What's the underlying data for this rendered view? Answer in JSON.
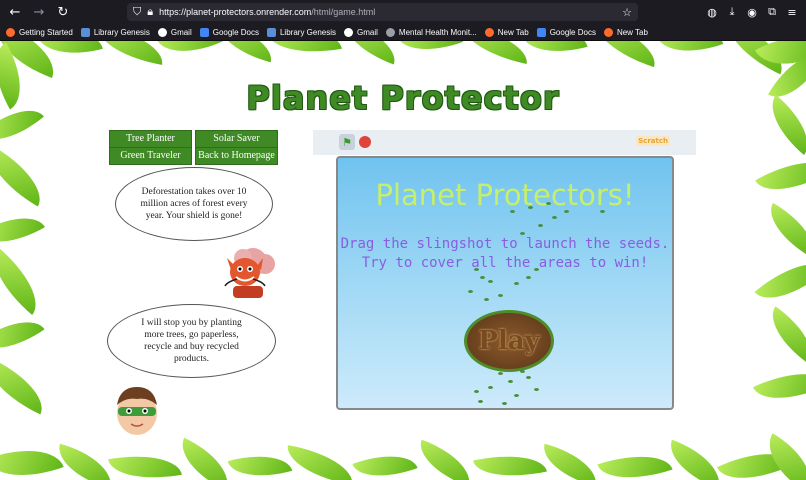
{
  "browser": {
    "url_host": "https://planet-protectors.onrender.com",
    "url_path": "/html/game.html",
    "bookmarks": [
      {
        "label": "Getting Started",
        "color": "#ff6b2d"
      },
      {
        "label": "Library Genesis",
        "color": "#5a8fd8"
      },
      {
        "label": "Gmail",
        "color": "#ffffff"
      },
      {
        "label": "Google Docs",
        "color": "#4285f4"
      },
      {
        "label": "Library Genesis",
        "color": "#5a8fd8"
      },
      {
        "label": "Gmail",
        "color": "#ffffff"
      },
      {
        "label": "Mental Health Monit...",
        "color": "#9aa0a6"
      },
      {
        "label": "New Tab",
        "color": "#ff6b2d"
      },
      {
        "label": "Google Docs",
        "color": "#4285f4"
      },
      {
        "label": "New Tab",
        "color": "#ff6b2d"
      }
    ]
  },
  "page": {
    "title": "Planet Protector",
    "nav": {
      "tree_planter": "Tree Planter",
      "solar_saver": "Solar Saver",
      "green_traveler": "Green Traveler",
      "back_home": "Back to Homepage"
    },
    "villain_speech": "Deforestation takes over 10 million acres of forest  every year. Your shield is gone!",
    "hero_speech": "I will stop you by planting more trees, go paperless, recycle and buy recycled products.",
    "stage_logo": "Scratch"
  },
  "game": {
    "title": "Planet Protectors!",
    "line1": "Drag the slingshot to launch the seeds.",
    "line2": "Try to cover all the areas to win!",
    "play_label": "Play"
  },
  "colors": {
    "brand_green": "#3f8a25",
    "stage_sky": "#70c3ef",
    "instruction_purple": "#8a5de0",
    "title_lime": "#c6ef6a"
  }
}
